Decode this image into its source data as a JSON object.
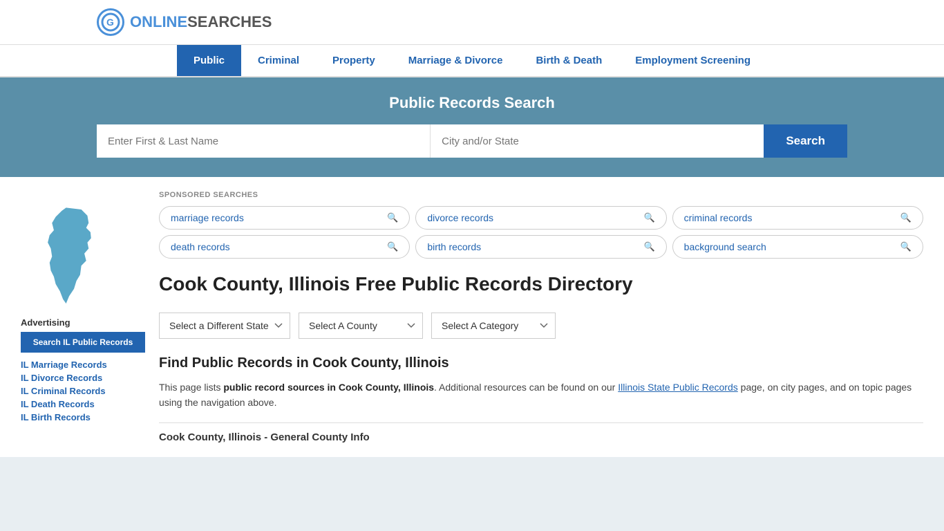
{
  "logo": {
    "icon_letter": "G",
    "text_online": "ONLINE",
    "text_searches": "SEARCHES"
  },
  "nav": {
    "items": [
      {
        "label": "Public",
        "active": true
      },
      {
        "label": "Criminal",
        "active": false
      },
      {
        "label": "Property",
        "active": false
      },
      {
        "label": "Marriage & Divorce",
        "active": false
      },
      {
        "label": "Birth & Death",
        "active": false
      },
      {
        "label": "Employment Screening",
        "active": false
      }
    ]
  },
  "hero": {
    "title": "Public Records Search",
    "name_placeholder": "Enter First & Last Name",
    "city_placeholder": "City and/or State",
    "search_label": "Search"
  },
  "sponsored": {
    "label": "SPONSORED SEARCHES",
    "tags": [
      {
        "label": "marriage records"
      },
      {
        "label": "divorce records"
      },
      {
        "label": "criminal records"
      },
      {
        "label": "death records"
      },
      {
        "label": "birth records"
      },
      {
        "label": "background search"
      }
    ]
  },
  "page": {
    "heading": "Cook County, Illinois Free Public Records Directory",
    "dropdowns": {
      "state": "Select a Different State",
      "county": "Select A County",
      "category": "Select A Category"
    },
    "find_heading": "Find Public Records in Cook County, Illinois",
    "find_para_1": "This page lists ",
    "find_para_bold": "public record sources in Cook County, Illinois",
    "find_para_2": ". Additional resources can be found on our ",
    "find_para_link": "Illinois State Public Records",
    "find_para_3": " page, on city pages, and on topic pages using the navigation above.",
    "county_info_heading": "Cook County, Illinois - General County Info"
  },
  "sidebar": {
    "ad_label": "Advertising",
    "btn_label": "Search IL Public Records",
    "links": [
      "IL Marriage Records",
      "IL Divorce Records",
      "IL Criminal Records",
      "IL Death Records",
      "IL Birth Records"
    ]
  }
}
